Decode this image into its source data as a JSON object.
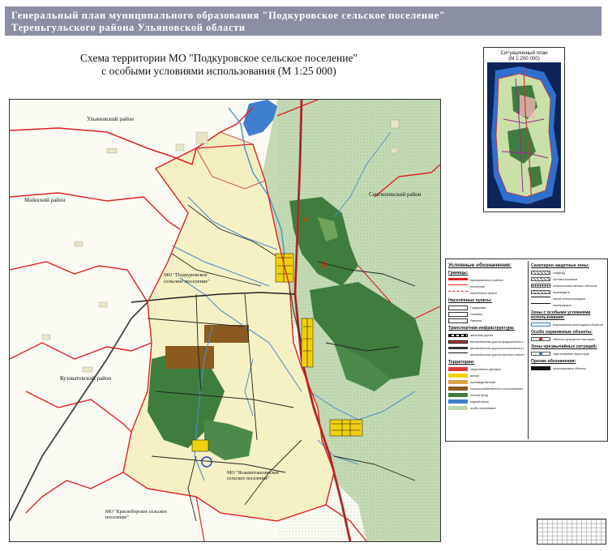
{
  "header": {
    "line1": "Генеральный план  муниципального образования \"Подкуровское сельское поселение\"",
    "line2": "Тереньгульского района Ульяновской области"
  },
  "title": {
    "line1": "Схема территории МО \"Подкуровское сельское поселение\"",
    "line2": "с особыми условиями использования (М 1:25 000)"
  },
  "map": {
    "labels": {
      "ulyanovsk_district": "Ульяновский район",
      "maina_district": "Майнский район",
      "kuzovatovo_district": "Кузоватовский район",
      "sengiley_district": "Сенгилеевский район",
      "mo_podkurovskoe": "МО \"Подкуровское сельское поселение\"",
      "mo_yasashnotashlinskoe": "МО \"Ясашноташлинское сельское поселение\"",
      "mo_krasnoborskoe": "МО \"Красноборское сельское поселение\"",
      "village_center": "Подкуровка"
    },
    "colors": {
      "settlement_zone": "#f6f2c6",
      "forest": "#3f7d3f",
      "light_forest": "#b7d4a6",
      "agro_brown": "#8b5a1e",
      "water": "#3f7fd0",
      "river": "#4a8fd0",
      "boundary": "#e01e1e",
      "road": "#111111",
      "highway": "#c63c3c",
      "built_up": "#f1d10c"
    }
  },
  "situation_map": {
    "title_line1": "Ситуационный план",
    "title_line2": "(М 1:200 000)"
  },
  "legend": {
    "title": "Условные обозначения:",
    "left": {
      "sections": [
        {
          "title": "Границы:",
          "items": [
            {
              "label": "муниципального района",
              "style": "red-thick"
            },
            {
              "label": "поселения",
              "style": "red"
            },
            {
              "label": "населённого пункта",
              "style": "red-dash"
            }
          ]
        },
        {
          "title": "Населённые пункты:",
          "items": [
            {
              "label": "Подкуровка",
              "style": "box"
            },
            {
              "label": "Сычёвка",
              "style": "box"
            },
            {
              "label": "Равнина",
              "style": "box"
            }
          ]
        },
        {
          "title": "Транспортная инфраструктура:",
          "items": [
            {
              "label": "железная дорога",
              "style": "rail"
            },
            {
              "label": "автомобильная дорога федерального значения",
              "style": "road-red"
            },
            {
              "label": "автомобильная дорога регионального значения",
              "style": "road-dark"
            },
            {
              "label": "автомобильная дорога местного значения",
              "style": "road-thin"
            }
          ]
        },
        {
          "title": "Территории:",
          "items": [
            {
              "label": "общественно-деловые",
              "style": "red-fill"
            },
            {
              "label": "жилые",
              "style": "yellow-fill"
            },
            {
              "label": "производственные",
              "style": "orange-fill"
            },
            {
              "label": "сельскохозяйственного использования",
              "style": "brown-fill"
            },
            {
              "label": "лесной фонд",
              "style": "green-fill"
            },
            {
              "label": "водный фонд",
              "style": "blue-fill"
            },
            {
              "label": "особо охраняемые",
              "style": "light-fill"
            }
          ]
        }
      ]
    },
    "right": {
      "sections": [
        {
          "title": "Санитарно-защитные зоны:",
          "items": [
            {
              "label": "кладбищ",
              "style": "hatch"
            },
            {
              "label": "скотомогильников",
              "style": "hatch"
            },
            {
              "label": "сельскохозяйственных объектов",
              "style": "dot"
            },
            {
              "label": "производств",
              "style": "hatch"
            },
            {
              "label": "линий электропередачи",
              "style": "line"
            },
            {
              "label": "газопроводов",
              "style": "line"
            }
          ]
        },
        {
          "title": "Зоны с особыми условиями использования:",
          "items": [
            {
              "label": "водоохранная зона водных объектов",
              "style": "blue-outline"
            }
          ]
        },
        {
          "title": "Особо охраняемые объекты:",
          "items": [
            {
              "label": "объекты культурного наследия",
              "style": "red-dot"
            }
          ]
        },
        {
          "title": "Зоны чрезвычайных ситуаций:",
          "items": [
            {
              "label": "подтопляемые территории",
              "style": "blue-dot"
            }
          ]
        },
        {
          "title": "Прочие обозначения:",
          "items": [
            {
              "label": "проектируемые объекты",
              "style": "black-box"
            }
          ]
        }
      ]
    }
  }
}
